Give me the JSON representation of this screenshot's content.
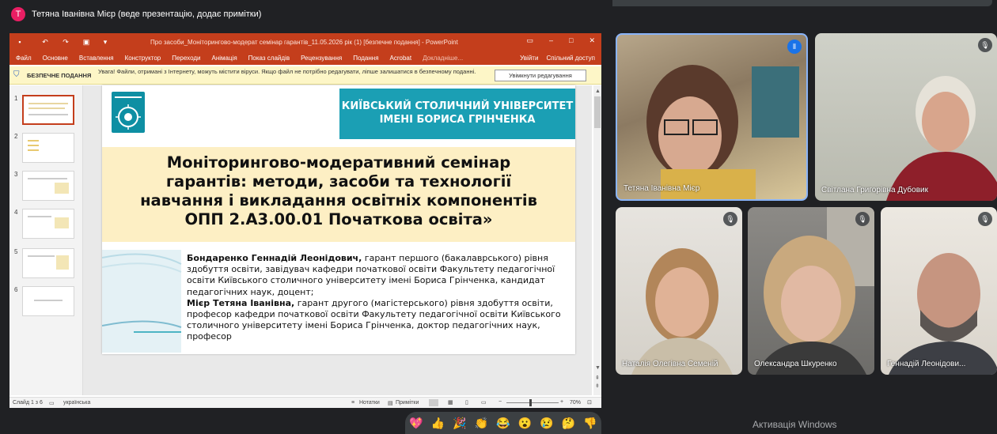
{
  "presenter": {
    "avatar_letter": "Т",
    "text": "Тетяна Іванівна Мієр (веде презентацію, додає примітки)"
  },
  "ppt": {
    "title": "Про засоби_Моніторингово-модерат семінар гарантів_11.05.2026 рік (1) [безпечне подання] - PowerPoint",
    "ribbon_tabs": [
      "Файл",
      "Основне",
      "Вставлення",
      "Конструктор",
      "Переходи",
      "Анімація",
      "Показ слайдів",
      "Рецензування",
      "Подання",
      "Acrobat",
      "Докладніше..."
    ],
    "ribbon_right": [
      "Увійти",
      "Спільний доступ"
    ],
    "security": {
      "title": "БЕЗПЕЧНЕ ПОДАННЯ",
      "message": "Увага! Файли, отримані з Інтернету, можуть містити віруси. Якщо файл не потрібно редагувати, ліпше залишатися в безпечному поданні.",
      "button": "Увімкнути редагування"
    },
    "thumb_numbers": [
      "1",
      "2",
      "3",
      "4",
      "5",
      "6"
    ],
    "status": {
      "slide": "Слайд 1 з 6",
      "lang": "українська",
      "notes": "Нотатки",
      "comments": "Примітки",
      "zoom": "70%"
    }
  },
  "slide": {
    "university": "КИЇВСЬКИЙ СТОЛИЧНИЙ УНІВЕРСИТЕТ\nІМЕНІ БОРИСА ГРІНЧЕНКА",
    "title_lines": [
      "Моніторингово-модеративний семінар",
      "гарантів: методи, засоби та технології",
      "навчання і викладання освітніх компонентів",
      "ОПП 2.А3.00.01 Початкова освіта»"
    ],
    "p1_name": "Бондаренко Геннадій Леонідович,",
    "p1_text": " гарант першого (бакалаврського) рівня здобуття освіти, завідувач кафедри початкової освіти Факультету педагогічної освіти Київського столичного університету імені Бориса Грінченка, кандидат педагогічних наук, доцент;",
    "p2_name": "Мієр Тетяна Іванівна,",
    "p2_text": " гарант другого (магістерського) рівня здобуття освіти, професор кафедри початкової освіти Факультету педагогічної освіти Київського столичного університету імені Бориса Грінченка, доктор педагогічних наук, професор"
  },
  "participants": [
    "Тетяна Іванівна Мієр",
    "Світлана Григорівна Дубовик",
    "Наталія Олегівна Семеній",
    "Олександра Шкуренко",
    "Геннадій Леонідови..."
  ],
  "reactions": [
    "💖",
    "👍",
    "🎉",
    "👏",
    "😂",
    "😮",
    "😢",
    "🤔",
    "👎"
  ],
  "activation": "Активація Windows"
}
